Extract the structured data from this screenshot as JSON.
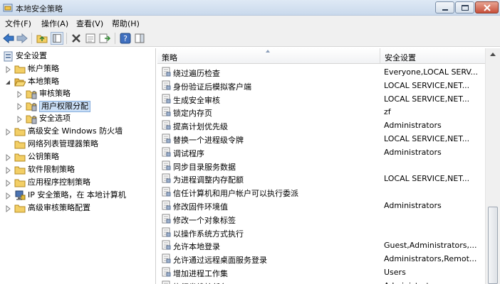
{
  "window": {
    "title": "本地安全策略"
  },
  "menu": [
    "文件(F)",
    "操作(A)",
    "查看(V)",
    "帮助(H)"
  ],
  "tree": [
    {
      "label": "安全设置",
      "icon": "security-settings-icon",
      "level": 0,
      "expander": "none"
    },
    {
      "label": "帐户策略",
      "icon": "folder-icon",
      "level": 1,
      "expander": "collapsed"
    },
    {
      "label": "本地策略",
      "icon": "folder-open-icon",
      "level": 1,
      "expander": "expanded"
    },
    {
      "label": "审核策略",
      "icon": "policy-folder-icon",
      "level": 2,
      "expander": "collapsed"
    },
    {
      "label": "用户权限分配",
      "icon": "policy-folder-icon",
      "level": 2,
      "expander": "collapsed",
      "selected": true
    },
    {
      "label": "安全选项",
      "icon": "policy-folder-icon",
      "level": 2,
      "expander": "collapsed"
    },
    {
      "label": "高级安全 Windows 防火墙",
      "icon": "folder-icon",
      "level": 1,
      "expander": "collapsed"
    },
    {
      "label": "网络列表管理器策略",
      "icon": "folder-icon",
      "level": 1,
      "expander": "none"
    },
    {
      "label": "公钥策略",
      "icon": "folder-icon",
      "level": 1,
      "expander": "collapsed"
    },
    {
      "label": "软件限制策略",
      "icon": "folder-icon",
      "level": 1,
      "expander": "collapsed"
    },
    {
      "label": "应用程序控制策略",
      "icon": "folder-icon",
      "level": 1,
      "expander": "collapsed"
    },
    {
      "label": "IP 安全策略，在 本地计算机",
      "icon": "ip-security-icon",
      "level": 1,
      "expander": "collapsed"
    },
    {
      "label": "高级审核策略配置",
      "icon": "folder-icon",
      "level": 1,
      "expander": "collapsed"
    }
  ],
  "columns": {
    "policy": "策略",
    "setting": "安全设置"
  },
  "rows": [
    {
      "name": "绕过遍历检查",
      "value": "Everyone,LOCAL SERV..."
    },
    {
      "name": "身份验证后模拟客户端",
      "value": "LOCAL SERVICE,NET..."
    },
    {
      "name": "生成安全审核",
      "value": "LOCAL SERVICE,NET..."
    },
    {
      "name": "锁定内存页",
      "value": "zf"
    },
    {
      "name": "提高计划优先级",
      "value": "Administrators"
    },
    {
      "name": "替换一个进程级令牌",
      "value": "LOCAL SERVICE,NET..."
    },
    {
      "name": "调试程序",
      "value": "Administrators"
    },
    {
      "name": "同步目录服务数据",
      "value": ""
    },
    {
      "name": "为进程调整内存配额",
      "value": "LOCAL SERVICE,NET..."
    },
    {
      "name": "信任计算机和用户帐户可以执行委派",
      "value": ""
    },
    {
      "name": "修改固件环境值",
      "value": "Administrators"
    },
    {
      "name": "修改一个对象标签",
      "value": ""
    },
    {
      "name": "以操作系统方式执行",
      "value": ""
    },
    {
      "name": "允许本地登录",
      "value": "Guest,Administrators,..."
    },
    {
      "name": "允许通过远程桌面服务登录",
      "value": "Administrators,Remot..."
    },
    {
      "name": "增加进程工作集",
      "value": "Users"
    },
    {
      "name": "执行卷维护任务",
      "value": "Administrators"
    }
  ],
  "colors": {
    "selection": "#cce0f7",
    "title_gradient": "#c9d9ec"
  }
}
